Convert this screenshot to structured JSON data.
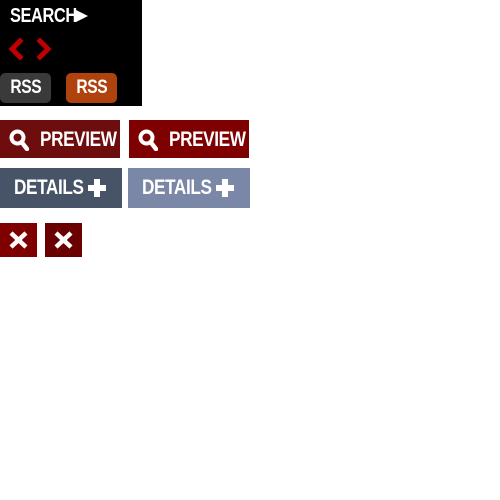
{
  "search": {
    "label": "SEARCH",
    "icon": "play-triangle-icon"
  },
  "pager": {
    "prev_icon": "chevron-left-icon",
    "next_icon": "chevron-right-icon",
    "color": "#c00000"
  },
  "rss": [
    {
      "label": "RSS",
      "color": "#3a3a3a"
    },
    {
      "label": "RSS",
      "color": "#b0420e"
    }
  ],
  "preview": [
    {
      "label": "PREVIEW",
      "icon": "magnifier-icon",
      "color": "#6d0d0d"
    },
    {
      "label": "PREVIEW",
      "icon": "magnifier-icon",
      "color": "#7e0000"
    }
  ],
  "details": [
    {
      "label": "DETAILS",
      "icon": "plus-icon",
      "color": "#475468"
    },
    {
      "label": "DETAILS",
      "icon": "plus-icon",
      "color": "#7b87a6"
    }
  ],
  "close": [
    {
      "icon": "close-icon",
      "color": "#7e0000"
    },
    {
      "icon": "close-icon",
      "color": "#6b0000"
    }
  ]
}
